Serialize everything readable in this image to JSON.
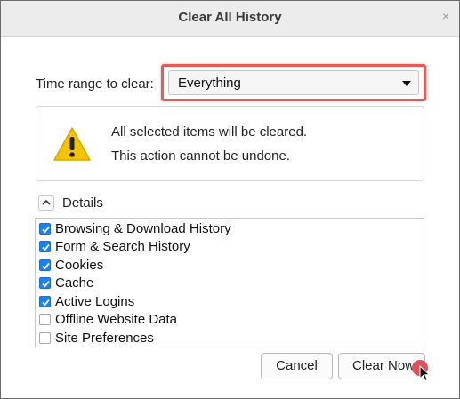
{
  "dialog": {
    "title": "Clear All History",
    "close_glyph": "×"
  },
  "time_range": {
    "label": "Time range to clear:",
    "selected": "Everything"
  },
  "warning": {
    "icon": "warning-triangle-icon",
    "line1": "All selected items will be cleared.",
    "line2": "This action cannot be undone."
  },
  "details": {
    "label": "Details",
    "expanded": true,
    "items": [
      {
        "label": "Browsing & Download History",
        "checked": true
      },
      {
        "label": "Form & Search History",
        "checked": true
      },
      {
        "label": "Cookies",
        "checked": true
      },
      {
        "label": "Cache",
        "checked": true
      },
      {
        "label": "Active Logins",
        "checked": true
      },
      {
        "label": "Offline Website Data",
        "checked": false
      },
      {
        "label": "Site Preferences",
        "checked": false
      }
    ]
  },
  "buttons": {
    "cancel": "Cancel",
    "clear_now": "Clear Now"
  },
  "colors": {
    "highlight": "#ea5a55",
    "checkbox_checked": "#1a82f6",
    "click_marker": "#e0505a",
    "warning_fill": "#f5c400"
  }
}
